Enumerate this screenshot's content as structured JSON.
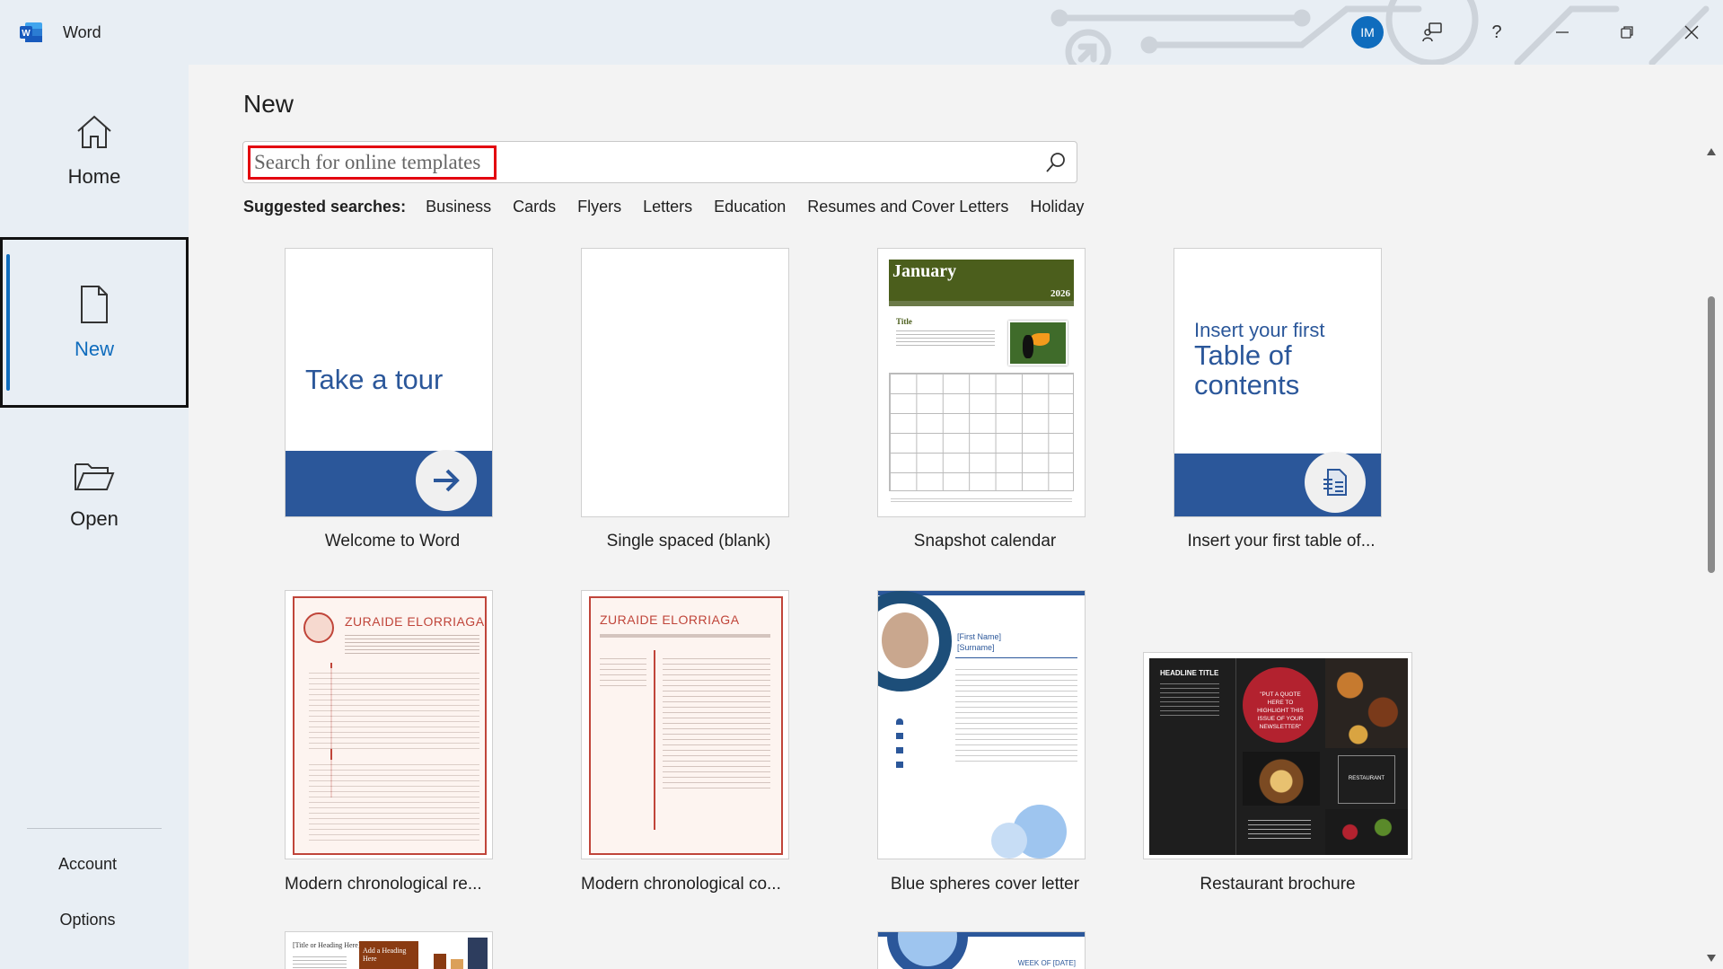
{
  "app": {
    "name": "Word",
    "user_initials": "IM"
  },
  "window_buttons": {
    "feedback": "feedback-icon",
    "help": "?",
    "minimize": "minimize-icon",
    "restore": "restore-icon",
    "close": "close-icon"
  },
  "nav": {
    "items": [
      {
        "label": "Home",
        "icon": "home-icon"
      },
      {
        "label": "New",
        "icon": "new-document-icon",
        "selected": true
      },
      {
        "label": "Open",
        "icon": "folder-open-icon"
      }
    ],
    "bottom": [
      {
        "label": "Account"
      },
      {
        "label": "Options"
      }
    ]
  },
  "main": {
    "title": "New",
    "search": {
      "placeholder": "Search for online templates",
      "value": ""
    },
    "suggested_label": "Suggested searches:",
    "suggested": [
      "Business",
      "Cards",
      "Flyers",
      "Letters",
      "Education",
      "Resumes and Cover Letters",
      "Holiday"
    ],
    "templates": [
      {
        "label": "Welcome to Word",
        "thumb_text": "Take a tour"
      },
      {
        "label": "Single spaced (blank)"
      },
      {
        "label": "Snapshot calendar",
        "thumb_month": "January",
        "thumb_year": "2026",
        "thumb_title": "Title"
      },
      {
        "label": "Insert your first table of...",
        "thumb_line1": "Insert your first",
        "thumb_line2": "Table of",
        "thumb_line3": "contents"
      },
      {
        "label": "Modern chronological re...",
        "thumb_name": "ZURAIDE ELORRIAGA"
      },
      {
        "label": "Modern chronological co...",
        "thumb_name": "ZURAIDE ELORRIAGA"
      },
      {
        "label": "Blue spheres cover letter",
        "thumb_line1": "[First Name]",
        "thumb_line2": "[Surname]"
      },
      {
        "label": "Restaurant brochure",
        "thumb_heading": "HEADLINE TITLE",
        "thumb_quote": "\"PUT A QUOTE HERE TO HIGHLIGHT THIS ISSUE OF YOUR NEWSLETTER\"",
        "thumb_badge": "RESTAURANT"
      },
      {
        "label": "",
        "thumb_text1": "[Title or Heading Here]",
        "thumb_text2": "Add a Heading Here"
      },
      {
        "label": "",
        "thumb_text": "WEEK OF [DATE]"
      }
    ]
  },
  "colors": {
    "accent": "#0f6cbd",
    "word_blue": "#2b579a",
    "highlight": "#e3000f",
    "calendar_green": "#4b5e1c"
  }
}
